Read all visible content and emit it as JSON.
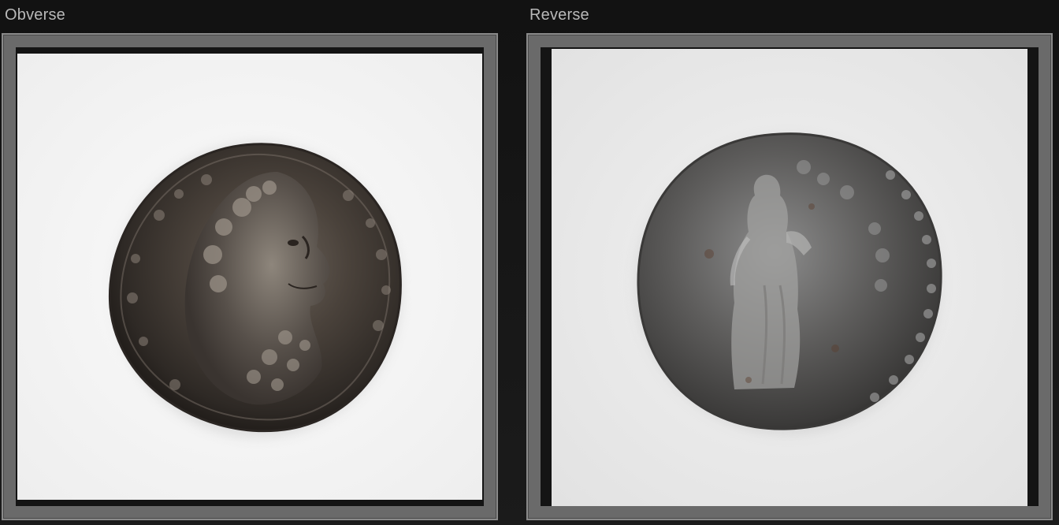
{
  "panels": {
    "obverse": {
      "label": "Obverse",
      "image": "obverse-coin-photo"
    },
    "reverse": {
      "label": "Reverse",
      "image": "reverse-coin-photo"
    }
  },
  "colors": {
    "background": "#151515",
    "frame": "#6a6a6a",
    "label_text": "#b8b8b8",
    "photo_background": "#efefef"
  }
}
